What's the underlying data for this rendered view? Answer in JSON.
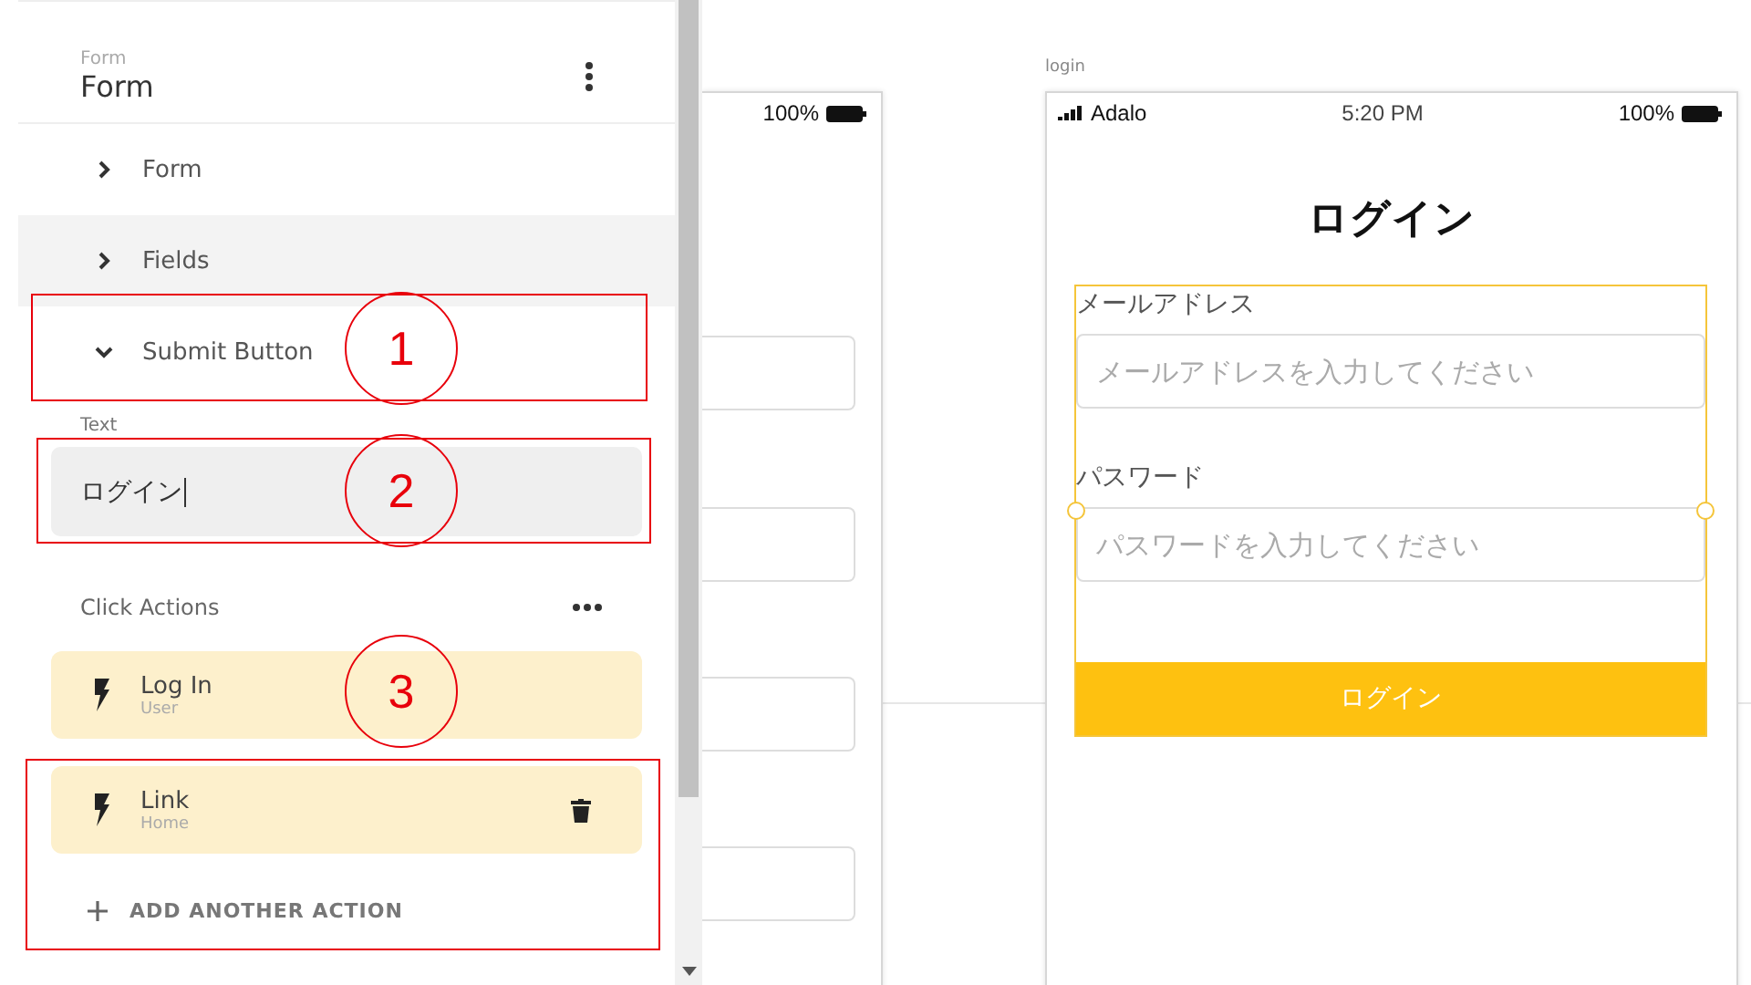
{
  "panel": {
    "subtitle": "Form",
    "title": "Form",
    "sections": [
      {
        "label": "Form",
        "expanded": false,
        "hovered": false
      },
      {
        "label": "Fields",
        "expanded": false,
        "hovered": true
      },
      {
        "label": "Submit Button",
        "expanded": true,
        "hovered": false
      }
    ],
    "text_field": {
      "label": "Text",
      "value": "ログイン"
    },
    "click_actions": {
      "title": "Click Actions",
      "actions": [
        {
          "name": "Log In",
          "target": "User",
          "hovered": false
        },
        {
          "name": "Link",
          "target": "Home",
          "hovered": true
        }
      ],
      "add_label": "ADD ANOTHER ACTION"
    }
  },
  "annotations": [
    "1",
    "2",
    "3"
  ],
  "canvas": {
    "back_screen": {
      "battery": "100%"
    },
    "screen": {
      "name": "login",
      "carrier": "Adalo",
      "time": "5:20 PM",
      "battery": "100%",
      "title": "ログイン",
      "fields": [
        {
          "label": "メールアドレス",
          "placeholder": "メールアドレスを入力してください"
        },
        {
          "label": "パスワード",
          "placeholder": "パスワードを入力してください"
        }
      ],
      "button": "ログイン"
    }
  }
}
